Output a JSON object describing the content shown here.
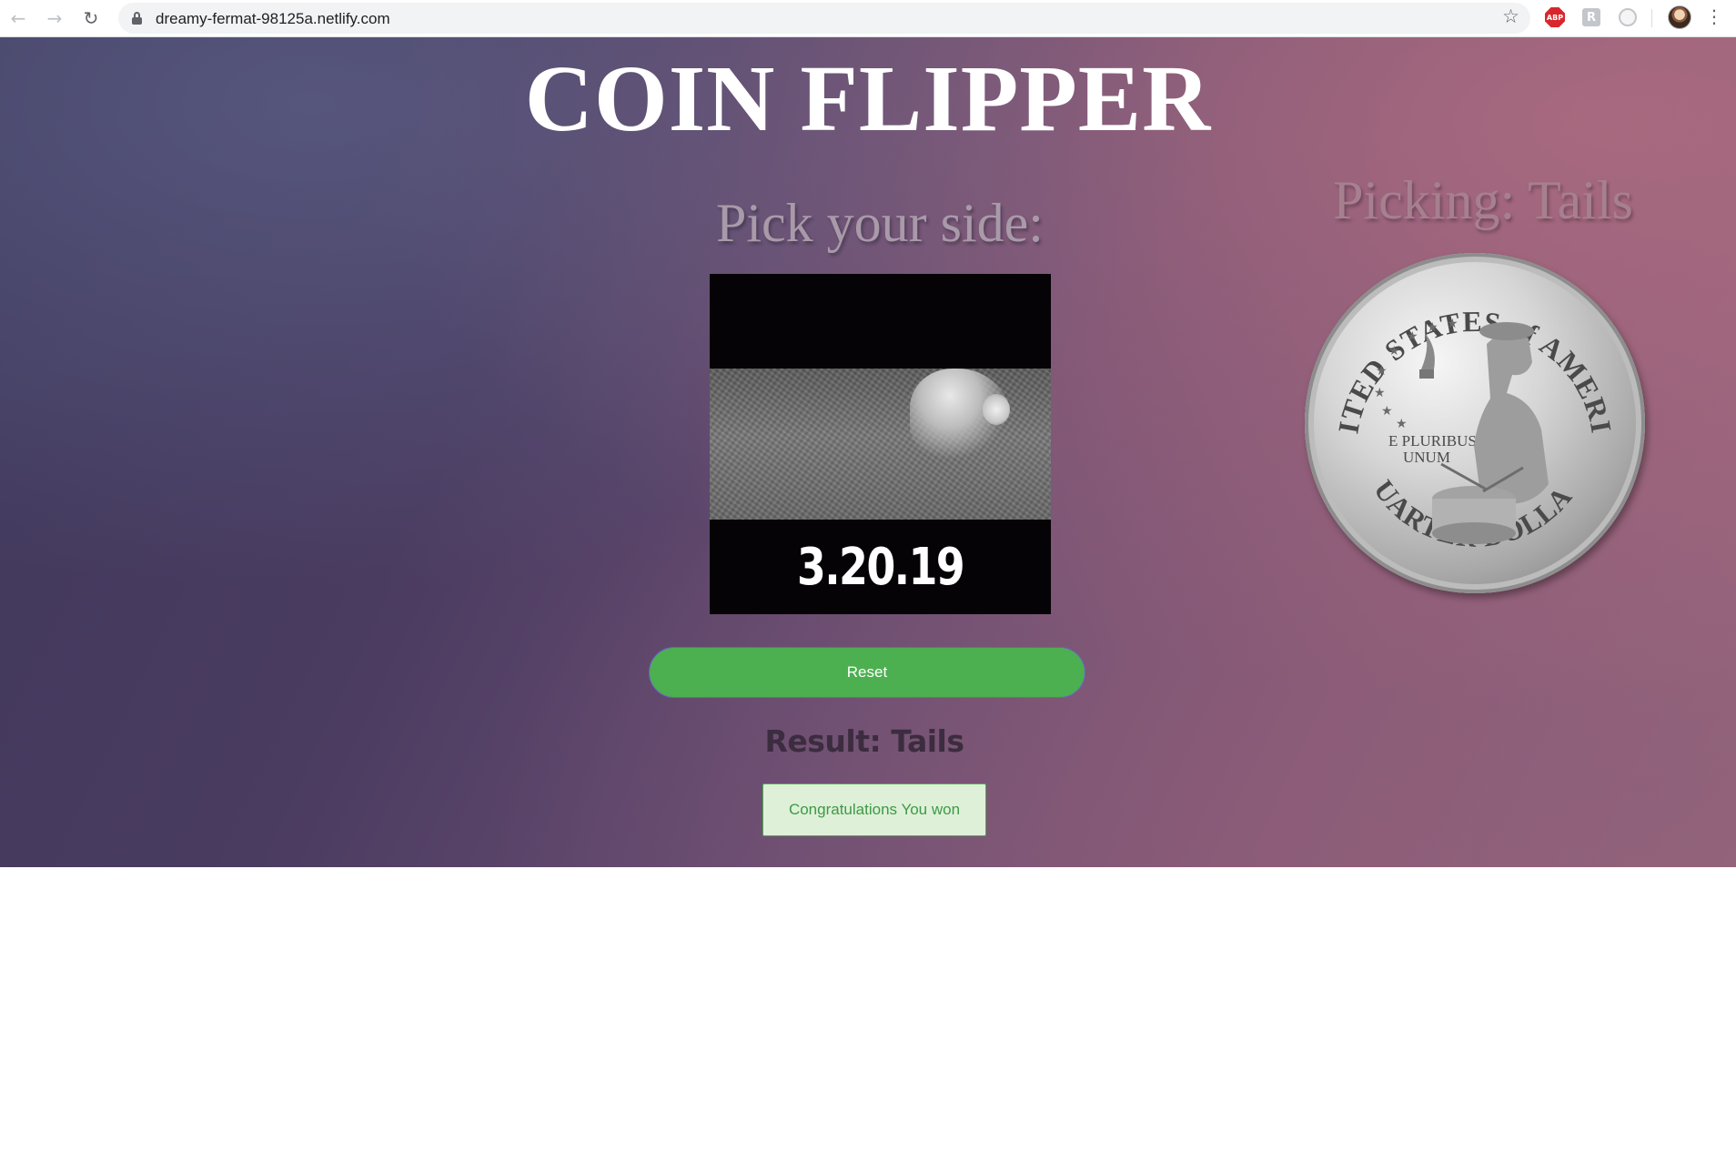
{
  "browser": {
    "url": "dreamy-fermat-98125a.netlify.com",
    "nav": {
      "back_icon": "←",
      "forward_icon": "→",
      "reload_icon": "↻"
    },
    "bookmark_icon": "☆",
    "extensions": {
      "abp_label": "ABP",
      "r_label": "R"
    },
    "menu_icon": "⋮"
  },
  "page": {
    "title": "COIN FLIPPER",
    "pick_heading": "Pick your side:",
    "picking_label": "Picking: Tails",
    "flip_image": {
      "date_text": "3.20.19"
    },
    "coin": {
      "top_text": "UNITED STATES of AMERICA",
      "bottom_text": "QUARTER DOLLAR",
      "motto_line1": "E PLURIBUS",
      "motto_line2": "UNUM"
    },
    "reset_label": "Reset",
    "result_text": "Result: Tails",
    "message_text": "Congratulations You won"
  },
  "colors": {
    "button_green": "#4caf50",
    "message_bg": "#dff0d8",
    "message_text": "#3c9a47"
  }
}
